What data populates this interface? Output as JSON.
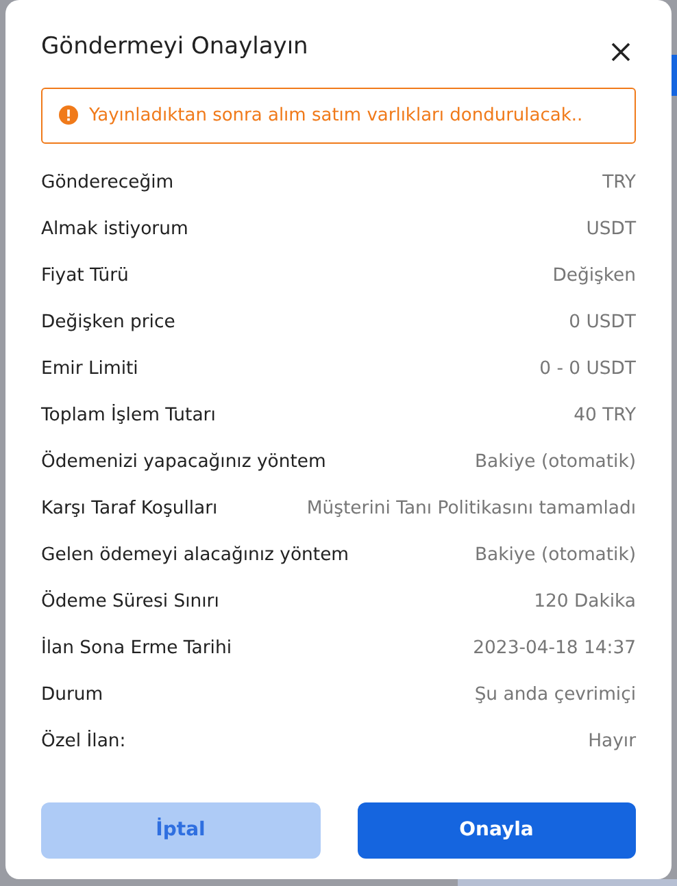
{
  "dialog": {
    "title": "Göndermeyi Onaylayın",
    "warning": "Yayınladıktan sonra alım satım varlıkları dondurulacak..",
    "rows": [
      {
        "label": "Göndereceğim",
        "value": "TRY"
      },
      {
        "label": "Almak istiyorum",
        "value": "USDT"
      },
      {
        "label": "Fiyat Türü",
        "value": "Değişken"
      },
      {
        "label": "Değişken price",
        "value": "0 USDT"
      },
      {
        "label": "Emir Limiti",
        "value": "0 - 0 USDT"
      },
      {
        "label": "Toplam İşlem Tutarı",
        "value": "40 TRY"
      },
      {
        "label": "Ödemenizi yapacağınız yöntem",
        "value": "Bakiye (otomatik)"
      },
      {
        "label": "Karşı Taraf Koşulları",
        "value": "Müşterini Tanı Politikasını tamamladı"
      },
      {
        "label": "Gelen ödemeyi alacağınız yöntem",
        "value": "Bakiye (otomatik)"
      },
      {
        "label": "Ödeme Süresi Sınırı",
        "value": "120 Dakika"
      },
      {
        "label": "İlan Sona Erme Tarihi",
        "value": "2023-04-18 14:37"
      },
      {
        "label": "Durum",
        "value": "Şu anda çevrimiçi"
      },
      {
        "label": "Özel İlan:",
        "value": "Hayır"
      }
    ],
    "buttons": [
      {
        "label": "İptal",
        "kind": "secondary"
      },
      {
        "label": "Onayla",
        "kind": "primary"
      }
    ]
  }
}
